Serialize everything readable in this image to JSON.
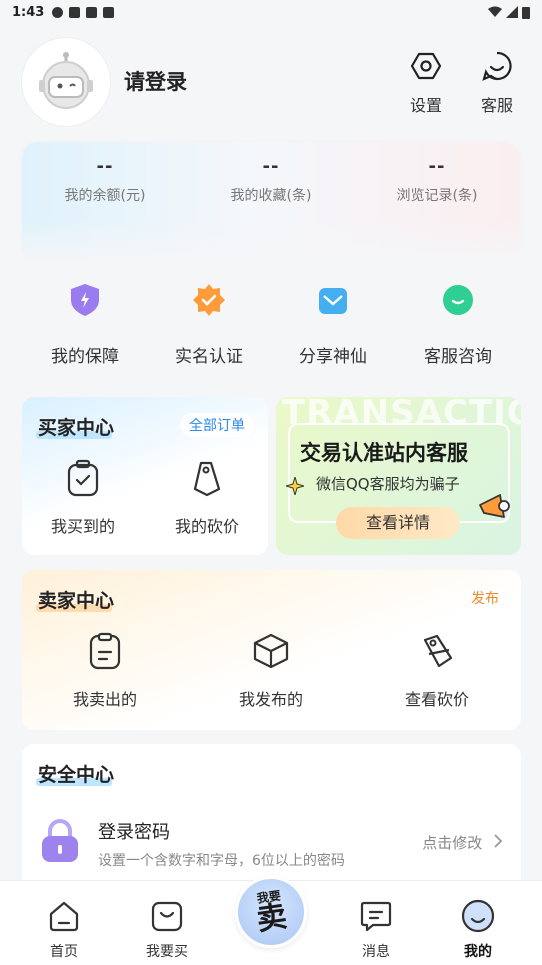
{
  "status": {
    "time": "1:43"
  },
  "header": {
    "login_label": "请登录",
    "settings_label": "设置",
    "service_label": "客服"
  },
  "stats": [
    {
      "value": "--",
      "label": "我的余额(元)"
    },
    {
      "value": "--",
      "label": "我的收藏(条)"
    },
    {
      "value": "--",
      "label": "浏览记录(条)"
    }
  ],
  "quick": [
    {
      "label": "我的保障",
      "icon": "shield-icon",
      "color": "#9b7cf0"
    },
    {
      "label": "实名认证",
      "icon": "verified-icon",
      "color": "#ff9b3a"
    },
    {
      "label": "分享神仙",
      "icon": "share-icon",
      "color": "#45aef0"
    },
    {
      "label": "客服咨询",
      "icon": "chat-icon",
      "color": "#2fce92"
    }
  ],
  "buyer": {
    "title": "买家中心",
    "all_orders": "全部订单",
    "items": [
      {
        "label": "我买到的",
        "icon": "bag-icon"
      },
      {
        "label": "我的砍价",
        "icon": "price-tag-icon"
      }
    ]
  },
  "banner": {
    "bg_word": "TRANSACTIO",
    "title": "交易认准站内客服",
    "subtitle": "微信QQ客服均为骗子",
    "button": "查看详情"
  },
  "seller": {
    "title": "卖家中心",
    "publish": "发布",
    "items": [
      {
        "label": "我卖出的",
        "icon": "note-icon"
      },
      {
        "label": "我发布的",
        "icon": "box-icon"
      },
      {
        "label": "查看砍价",
        "icon": "price-tag-icon"
      }
    ]
  },
  "security": {
    "title": "安全中心",
    "row_title": "登录密码",
    "row_desc": "设置一个含数字和字母，6位以上的密码",
    "row_action": "点击修改"
  },
  "tabbar": {
    "tabs": [
      {
        "label": "首页",
        "icon": "home-icon"
      },
      {
        "label": "我要买",
        "icon": "bag-icon"
      },
      {
        "label": "消息",
        "icon": "message-icon"
      },
      {
        "label": "我的",
        "icon": "profile-icon"
      }
    ],
    "sell_top": "我要",
    "sell_main": "卖"
  },
  "colors": {
    "accent_blue": "#bfe6ff",
    "accent_orange": "#ffdcb0",
    "publish_orange": "#f08a24",
    "all_orders_blue": "#2b8be8"
  }
}
